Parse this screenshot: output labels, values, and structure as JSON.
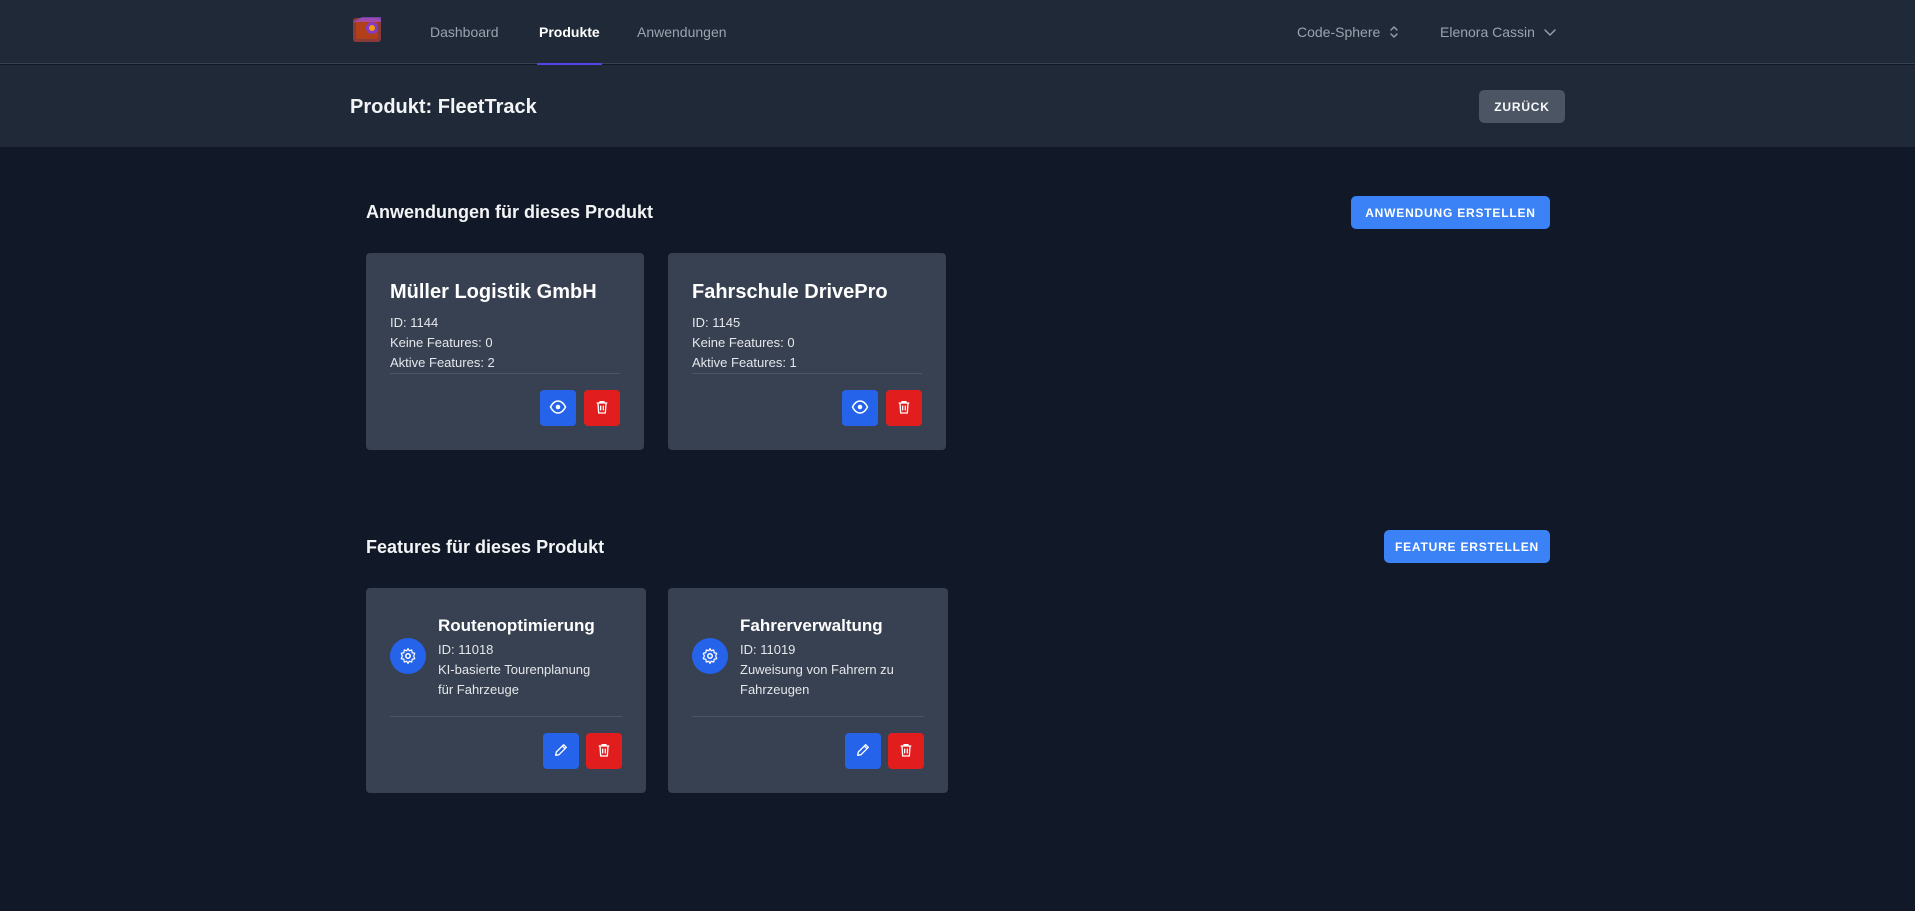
{
  "nav": {
    "links": [
      {
        "label": "Dashboard"
      },
      {
        "label": "Produkte",
        "active": true
      },
      {
        "label": "Anwendungen"
      }
    ],
    "workspace": "Code-Sphere",
    "user": "Elenora Cassin"
  },
  "header": {
    "title": "Produkt: FleetTrack",
    "back_label": "ZURÜCK"
  },
  "applications": {
    "title": "Anwendungen für dieses Produkt",
    "create_label": "ANWENDUNG ERSTELLEN",
    "items": [
      {
        "name": "Müller Logistik GmbH",
        "id_line": "ID: 1144",
        "no_features_line": "Keine Features: 0",
        "active_features_line": "Aktive Features: 2"
      },
      {
        "name": "Fahrschule DrivePro",
        "id_line": "ID: 1145",
        "no_features_line": "Keine Features: 0",
        "active_features_line": "Aktive Features: 1"
      }
    ]
  },
  "features": {
    "title": "Features für dieses Produkt",
    "create_label": "FEATURE ERSTELLEN",
    "items": [
      {
        "name": "Routenoptimierung",
        "id_line": "ID: 11018",
        "desc_line1": "KI-basierte Tourenplanung",
        "desc_line2": "für Fahrzeuge"
      },
      {
        "name": "Fahrerverwaltung",
        "id_line": "ID: 11019",
        "desc_line1": "Zuweisung von Fahrern zu",
        "desc_line2": "Fahrzeugen"
      }
    ]
  },
  "colors": {
    "accent": "#3b82f6",
    "danger": "#e11d1d",
    "background": "#111827",
    "card": "#374151"
  },
  "icons": [
    "logo-icon",
    "chevron-updown-icon",
    "chevron-down-icon",
    "eye-icon",
    "trash-icon",
    "gear-icon",
    "pencil-icon"
  ]
}
